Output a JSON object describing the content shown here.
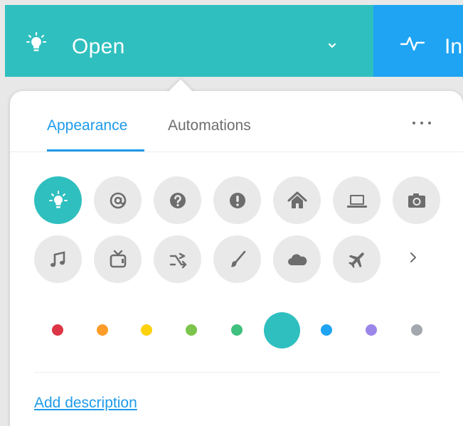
{
  "status_bar": {
    "label": "Open",
    "color": "#30bfbf",
    "icon": "lightbulb-icon"
  },
  "next_panel": {
    "label": "In",
    "color": "#1ea4f3",
    "icon": "pulse-icon"
  },
  "tabs": [
    {
      "label": "Appearance",
      "active": true
    },
    {
      "label": "Automations",
      "active": false
    }
  ],
  "icons": {
    "selected": "lightbulb-icon",
    "row1": [
      "lightbulb-icon",
      "at-sign-icon",
      "question-icon",
      "exclamation-icon",
      "home-icon",
      "laptop-icon",
      "camera-icon"
    ],
    "row2": [
      "music-note-icon",
      "tv-icon",
      "shuffle-icon",
      "paintbrush-icon",
      "cloud-icon",
      "airplane-icon"
    ],
    "more": "chevron-right-icon"
  },
  "colors": {
    "options": [
      "#dc3545",
      "#fd9c28",
      "#fdd10b",
      "#7cc44b",
      "#3fc07e",
      "#30bfbf",
      "#1ea4f3",
      "#9a86e8",
      "#a3a8af"
    ],
    "selected": "#30bfbf"
  },
  "footer": {
    "add_description_label": "Add description"
  }
}
